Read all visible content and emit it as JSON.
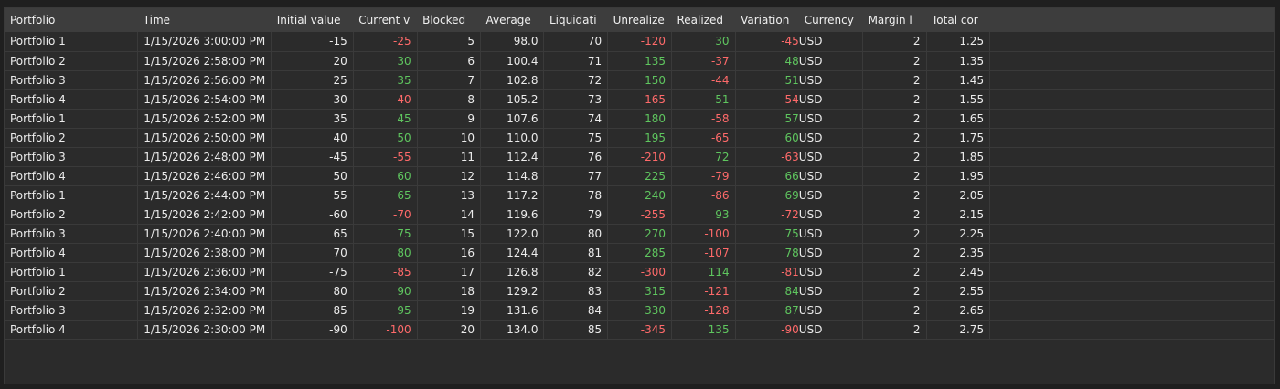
{
  "columns": [
    "Portfolio",
    "Time",
    "Initial value",
    "Current v",
    "Blocked",
    "Average",
    "Liquidati",
    "Unrealize",
    "Realized",
    "Variation",
    "Currency",
    "Margin l",
    "Total cor"
  ],
  "rows": [
    {
      "portfolio": "Portfolio 1",
      "time": "1/15/2026 3:00:00 PM",
      "initial": "-15",
      "current": "-25",
      "blocked": "5",
      "average": "98.0",
      "liquidation": "70",
      "unrealized": "-120",
      "realized": "30",
      "variation": "-45",
      "currency": "USD",
      "margin": "2",
      "total": "1.25"
    },
    {
      "portfolio": "Portfolio 2",
      "time": "1/15/2026 2:58:00 PM",
      "initial": "20",
      "current": "30",
      "blocked": "6",
      "average": "100.4",
      "liquidation": "71",
      "unrealized": "135",
      "realized": "-37",
      "variation": "48",
      "currency": "USD",
      "margin": "2",
      "total": "1.35"
    },
    {
      "portfolio": "Portfolio 3",
      "time": "1/15/2026 2:56:00 PM",
      "initial": "25",
      "current": "35",
      "blocked": "7",
      "average": "102.8",
      "liquidation": "72",
      "unrealized": "150",
      "realized": "-44",
      "variation": "51",
      "currency": "USD",
      "margin": "2",
      "total": "1.45"
    },
    {
      "portfolio": "Portfolio 4",
      "time": "1/15/2026 2:54:00 PM",
      "initial": "-30",
      "current": "-40",
      "blocked": "8",
      "average": "105.2",
      "liquidation": "73",
      "unrealized": "-165",
      "realized": "51",
      "variation": "-54",
      "currency": "USD",
      "margin": "2",
      "total": "1.55"
    },
    {
      "portfolio": "Portfolio 1",
      "time": "1/15/2026 2:52:00 PM",
      "initial": "35",
      "current": "45",
      "blocked": "9",
      "average": "107.6",
      "liquidation": "74",
      "unrealized": "180",
      "realized": "-58",
      "variation": "57",
      "currency": "USD",
      "margin": "2",
      "total": "1.65"
    },
    {
      "portfolio": "Portfolio 2",
      "time": "1/15/2026 2:50:00 PM",
      "initial": "40",
      "current": "50",
      "blocked": "10",
      "average": "110.0",
      "liquidation": "75",
      "unrealized": "195",
      "realized": "-65",
      "variation": "60",
      "currency": "USD",
      "margin": "2",
      "total": "1.75"
    },
    {
      "portfolio": "Portfolio 3",
      "time": "1/15/2026 2:48:00 PM",
      "initial": "-45",
      "current": "-55",
      "blocked": "11",
      "average": "112.4",
      "liquidation": "76",
      "unrealized": "-210",
      "realized": "72",
      "variation": "-63",
      "currency": "USD",
      "margin": "2",
      "total": "1.85"
    },
    {
      "portfolio": "Portfolio 4",
      "time": "1/15/2026 2:46:00 PM",
      "initial": "50",
      "current": "60",
      "blocked": "12",
      "average": "114.8",
      "liquidation": "77",
      "unrealized": "225",
      "realized": "-79",
      "variation": "66",
      "currency": "USD",
      "margin": "2",
      "total": "1.95"
    },
    {
      "portfolio": "Portfolio 1",
      "time": "1/15/2026 2:44:00 PM",
      "initial": "55",
      "current": "65",
      "blocked": "13",
      "average": "117.2",
      "liquidation": "78",
      "unrealized": "240",
      "realized": "-86",
      "variation": "69",
      "currency": "USD",
      "margin": "2",
      "total": "2.05"
    },
    {
      "portfolio": "Portfolio 2",
      "time": "1/15/2026 2:42:00 PM",
      "initial": "-60",
      "current": "-70",
      "blocked": "14",
      "average": "119.6",
      "liquidation": "79",
      "unrealized": "-255",
      "realized": "93",
      "variation": "-72",
      "currency": "USD",
      "margin": "2",
      "total": "2.15"
    },
    {
      "portfolio": "Portfolio 3",
      "time": "1/15/2026 2:40:00 PM",
      "initial": "65",
      "current": "75",
      "blocked": "15",
      "average": "122.0",
      "liquidation": "80",
      "unrealized": "270",
      "realized": "-100",
      "variation": "75",
      "currency": "USD",
      "margin": "2",
      "total": "2.25"
    },
    {
      "portfolio": "Portfolio 4",
      "time": "1/15/2026 2:38:00 PM",
      "initial": "70",
      "current": "80",
      "blocked": "16",
      "average": "124.4",
      "liquidation": "81",
      "unrealized": "285",
      "realized": "-107",
      "variation": "78",
      "currency": "USD",
      "margin": "2",
      "total": "2.35"
    },
    {
      "portfolio": "Portfolio 1",
      "time": "1/15/2026 2:36:00 PM",
      "initial": "-75",
      "current": "-85",
      "blocked": "17",
      "average": "126.8",
      "liquidation": "82",
      "unrealized": "-300",
      "realized": "114",
      "variation": "-81",
      "currency": "USD",
      "margin": "2",
      "total": "2.45"
    },
    {
      "portfolio": "Portfolio 2",
      "time": "1/15/2026 2:34:00 PM",
      "initial": "80",
      "current": "90",
      "blocked": "18",
      "average": "129.2",
      "liquidation": "83",
      "unrealized": "315",
      "realized": "-121",
      "variation": "84",
      "currency": "USD",
      "margin": "2",
      "total": "2.55"
    },
    {
      "portfolio": "Portfolio 3",
      "time": "1/15/2026 2:32:00 PM",
      "initial": "85",
      "current": "95",
      "blocked": "19",
      "average": "131.6",
      "liquidation": "84",
      "unrealized": "330",
      "realized": "-128",
      "variation": "87",
      "currency": "USD",
      "margin": "2",
      "total": "2.65"
    },
    {
      "portfolio": "Portfolio 4",
      "time": "1/15/2026 2:30:00 PM",
      "initial": "-90",
      "current": "-100",
      "blocked": "20",
      "average": "134.0",
      "liquidation": "85",
      "unrealized": "-345",
      "realized": "135",
      "variation": "-90",
      "currency": "USD",
      "margin": "2",
      "total": "2.75"
    }
  ],
  "colors": {
    "positive": "#5fc65f",
    "negative": "#ff6a6a",
    "header_bg": "#3d3d3d",
    "grid_bg": "#2b2b2b",
    "page_bg": "#1f1f1f"
  }
}
